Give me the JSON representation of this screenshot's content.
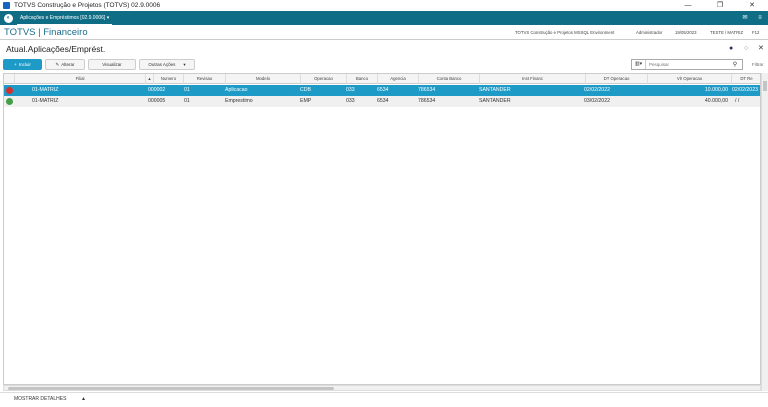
{
  "window": {
    "title": "TOTVS Construção e Projetos (TOTVS) 02.9.0006",
    "controls": [
      "—",
      "❐",
      "✕"
    ]
  },
  "topbar": {
    "tab_label": "Aplicações e Empréstimos [02.9.0006]",
    "icons": [
      "✉",
      "≡"
    ]
  },
  "appbar": {
    "brand": "TOTVS | Financeiro",
    "environment": "TOTVS Construção e Projetos MSSQL Environment",
    "user": "Administrador",
    "date": "19/05/2023",
    "branch": "TESTE / MATRIZ",
    "shortcut": "F12"
  },
  "page": {
    "title": "Atual.Aplicações/Emprést.",
    "header_icons": [
      "●",
      "○",
      "✕"
    ]
  },
  "toolbar": {
    "incluir": "Incluir",
    "alterar": "Alterar",
    "visualizar": "Visualizar",
    "outras_acoes": "Outras Ações"
  },
  "search": {
    "placeholder": "Pesquisar",
    "filter_label": "Filtrar"
  },
  "grid": {
    "columns": [
      "",
      "Filial",
      "",
      "Numero",
      "Revisao",
      "Modelo",
      "Operacao",
      "Banco",
      "Agencia",
      "Conta Banco",
      "Inst Financ",
      "DT Operacao",
      "Vlr Operacao",
      "DT Re"
    ],
    "rows": [
      {
        "status": "red",
        "filial": "01-MATRIZ",
        "numero": "000002",
        "revisao": "01",
        "modelo": "Aplicacao",
        "operacao": "CDB",
        "banco": "033",
        "agencia": "6534",
        "conta": "786534",
        "inst": "SANTANDER",
        "dt_operacao": "02/02/2022",
        "vlr_operacao": "10.000,00",
        "dt_resgate": "02/02/2023"
      },
      {
        "status": "green",
        "filial": "01-MATRIZ",
        "numero": "000005",
        "revisao": "01",
        "modelo": "Emprestimo",
        "operacao": "EMP",
        "banco": "033",
        "agencia": "6534",
        "conta": "786534",
        "inst": "SANTANDER",
        "dt_operacao": "03/02/2022",
        "vlr_operacao": "40.000,00",
        "dt_resgate": "/ /"
      }
    ]
  },
  "footer": {
    "details_label": "MOSTRAR DETALHES",
    "arrow": "▲"
  },
  "colors": {
    "topbar": "#0f6e86",
    "accent": "#1e9ac6",
    "brand_text": "#1a6d8c",
    "status_red": "#d32f2f",
    "status_green": "#43a047"
  }
}
